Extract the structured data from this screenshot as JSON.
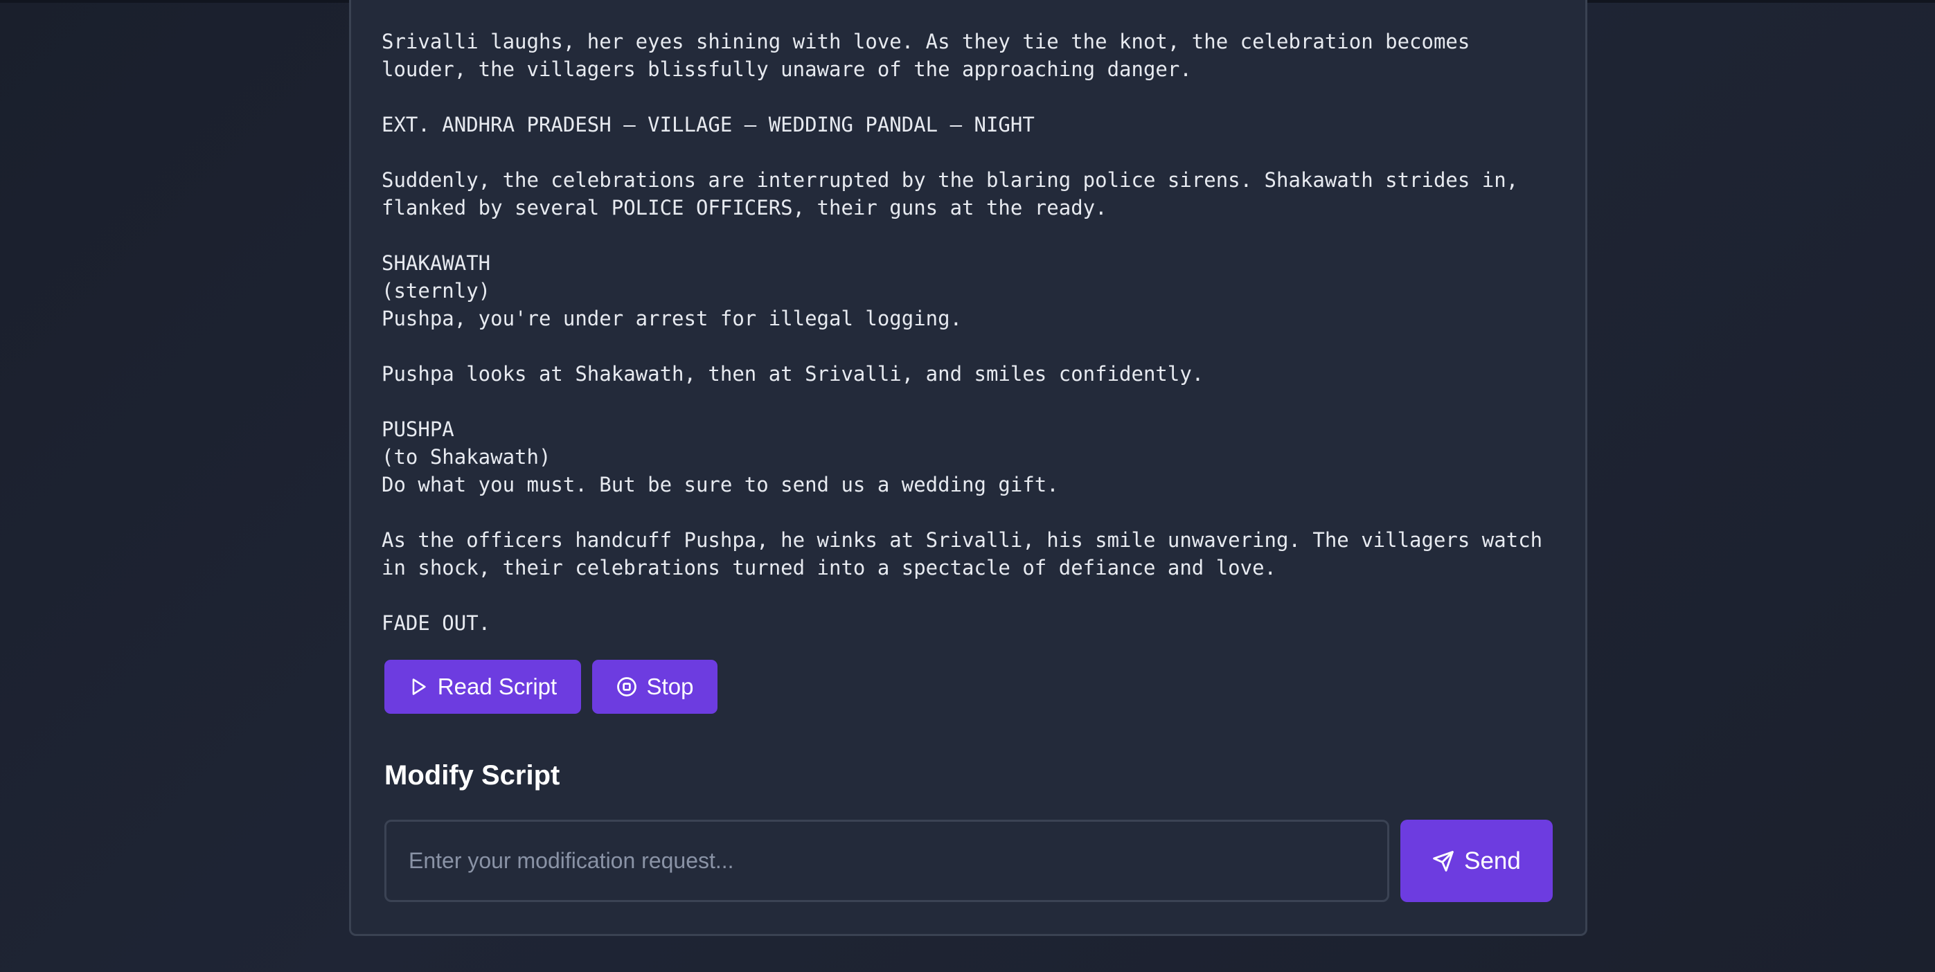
{
  "script": {
    "text": "Srivalli laughs, her eyes shining with love. As they tie the knot, the celebration becomes\nlouder, the villagers blissfully unaware of the approaching danger.\n\nEXT. ANDHRA PRADESH – VILLAGE – WEDDING PANDAL – NIGHT\n\nSuddenly, the celebrations are interrupted by the blaring police sirens. Shakawath strides in,\nflanked by several POLICE OFFICERS, their guns at the ready.\n\nSHAKAWATH\n(sternly)\nPushpa, you're under arrest for illegal logging.\n\nPushpa looks at Shakawath, then at Srivalli, and smiles confidently.\n\nPUSHPA\n(to Shakawath)\nDo what you must. But be sure to send us a wedding gift.\n\nAs the officers handcuff Pushpa, he winks at Srivalli, his smile unwavering. The villagers watch\nin shock, their celebrations turned into a spectacle of defiance and love.\n\nFADE OUT."
  },
  "controls": {
    "read_label": "Read Script",
    "read_icon": "play-icon",
    "stop_label": "Stop",
    "stop_icon": "stop-circle-icon"
  },
  "modify": {
    "title": "Modify Script",
    "input_value": "",
    "input_placeholder": "Enter your modification request...",
    "send_label": "Send",
    "send_icon": "send-icon"
  },
  "colors": {
    "background": "#1c2230",
    "card": "#232a3a",
    "accent": "#6d3ce0",
    "text": "#e7eaf0"
  }
}
